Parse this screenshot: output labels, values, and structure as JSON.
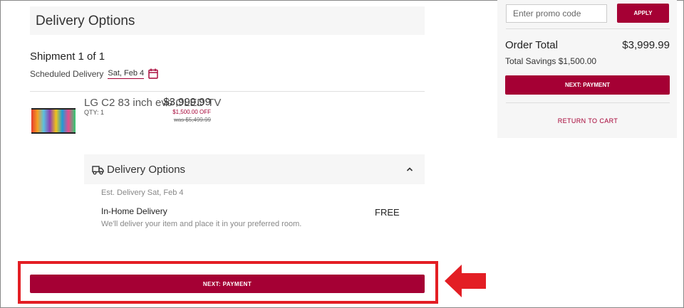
{
  "main": {
    "section_title": "Delivery Options",
    "shipment_label": "Shipment 1 of 1",
    "scheduled_label": "Scheduled Delivery",
    "scheduled_date": "Sat, Feb 4",
    "product": {
      "name": "LG C2 83 inch evo OLED TV",
      "qty": "QTY: 1",
      "price": "$3,999.99",
      "discount": "$1,500.00 OFF",
      "was_price": "was $5,499.99"
    },
    "delivery_options": {
      "title": "Delivery Options",
      "estimate": "Est. Delivery Sat, Feb 4",
      "method": "In-Home Delivery",
      "method_price": "FREE",
      "description": "We'll deliver your item and place it in your preferred room."
    },
    "next_button": "NEXT: PAYMENT"
  },
  "sidebar": {
    "promo_placeholder": "Enter promo code",
    "apply_label": "APPLY",
    "order_total_label": "Order Total",
    "order_total_value": "$3,999.99",
    "savings": "Total Savings $1,500.00",
    "next_button": "NEXT: PAYMENT",
    "return_link": "RETURN TO CART"
  },
  "colors": {
    "brand": "#a50034",
    "highlight": "#e31e24",
    "panel_bg": "#f6f6f6"
  },
  "icons": [
    "calendar-icon",
    "truck-icon",
    "chevron-up-icon",
    "red-arrow-annotation"
  ]
}
